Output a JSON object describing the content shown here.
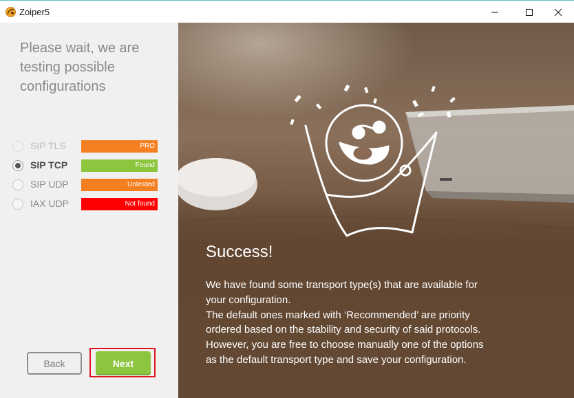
{
  "window": {
    "title": "Zoiper5",
    "controls": [
      "minimize-icon",
      "maximize-icon",
      "close-icon"
    ]
  },
  "left": {
    "heading": "Please wait, we are testing possible configurations",
    "transports": [
      {
        "label": "SIP TLS",
        "status": "PRO",
        "status_color": "#f47f20",
        "state": "disabled"
      },
      {
        "label": "SIP TCP",
        "status": "Found",
        "status_color": "#8cc63f",
        "state": "selected"
      },
      {
        "label": "SIP UDP",
        "status": "Untested",
        "status_color": "#f47f20",
        "state": "available"
      },
      {
        "label": "IAX UDP",
        "status": "Not found",
        "status_color": "#ff0000",
        "state": "available"
      }
    ],
    "back_label": "Back",
    "next_label": "Next"
  },
  "right": {
    "title": "Success!",
    "body_lines": [
      "We have found some transport type(s) that are available for",
      "your configuration.",
      "The default ones marked with ‘Recommended’ are priority",
      "ordered based on the stability and security of said protocols.",
      "However, you are free to choose manually one of the options",
      "as the default  transport type and save your configuration."
    ]
  },
  "colors": {
    "accent_green": "#8cc63f",
    "highlight_red": "#e0131f",
    "left_bg": "#f0f0f0"
  }
}
